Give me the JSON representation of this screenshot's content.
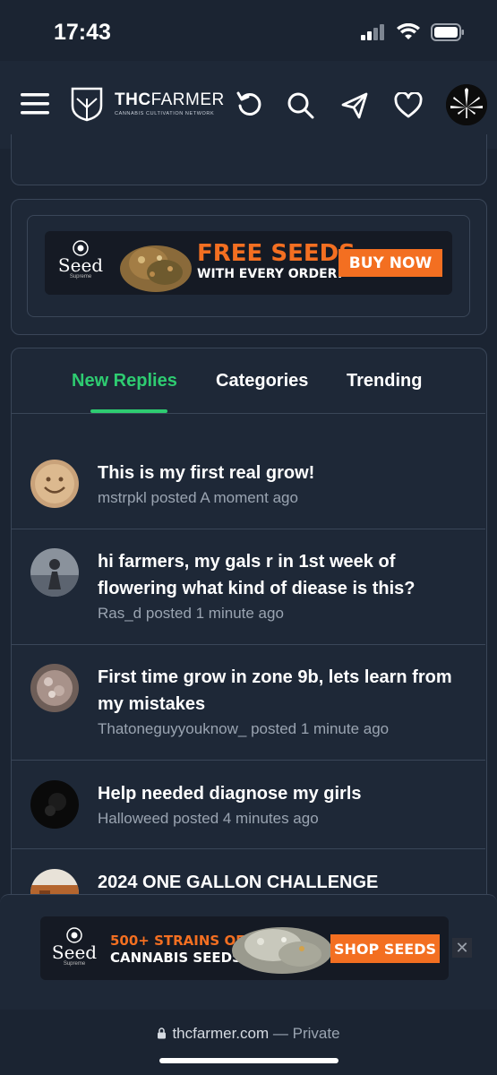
{
  "status": {
    "time": "17:43"
  },
  "header": {
    "logo_main_bold": "THC",
    "logo_main_light": "FARMER",
    "logo_sub": "CANNABIS CULTIVATION NETWORK",
    "icons": [
      "menu-icon",
      "refresh-icon",
      "search-icon",
      "send-icon",
      "heart-icon",
      "user-avatar"
    ]
  },
  "ad_top": {
    "brand": "Seed",
    "brand_sub": "Supreme",
    "headline": "FREE SEEDS",
    "subline": "WITH EVERY ORDER!",
    "cta": "BUY NOW"
  },
  "tabs": [
    {
      "label": "New Replies",
      "active": true
    },
    {
      "label": "Categories",
      "active": false
    },
    {
      "label": "Trending",
      "active": false
    }
  ],
  "threads": [
    {
      "title": "This is my first real grow!",
      "meta": "mstrpkl posted A moment ago"
    },
    {
      "title": "hi farmers, my gals r in 1st week of flowering what kind of diease is this?",
      "meta": "Ras_d posted 1 minute ago"
    },
    {
      "title": "First time grow in zone 9b, lets learn from my mistakes",
      "meta": "Thatoneguyyouknow_ posted 1 minute ago"
    },
    {
      "title": "Help needed diagnose my girls",
      "meta": "Halloweed posted 4 minutes ago"
    },
    {
      "title": "2024 ONE GALLON CHALLENGE",
      "meta": ""
    }
  ],
  "ad_bottom": {
    "brand": "Seed",
    "brand_sub": "Supreme",
    "headline": "500+ STRAINS OF",
    "subline": "CANNABIS SEEDS",
    "cta": "SHOP SEEDS",
    "close": "✕"
  },
  "browser": {
    "url": "thcfarmer.com",
    "privacy": "— Private"
  },
  "colors": {
    "accent": "#2ecc71",
    "orange": "#f36f21",
    "background": "#1b2432",
    "card": "#1e2837"
  }
}
